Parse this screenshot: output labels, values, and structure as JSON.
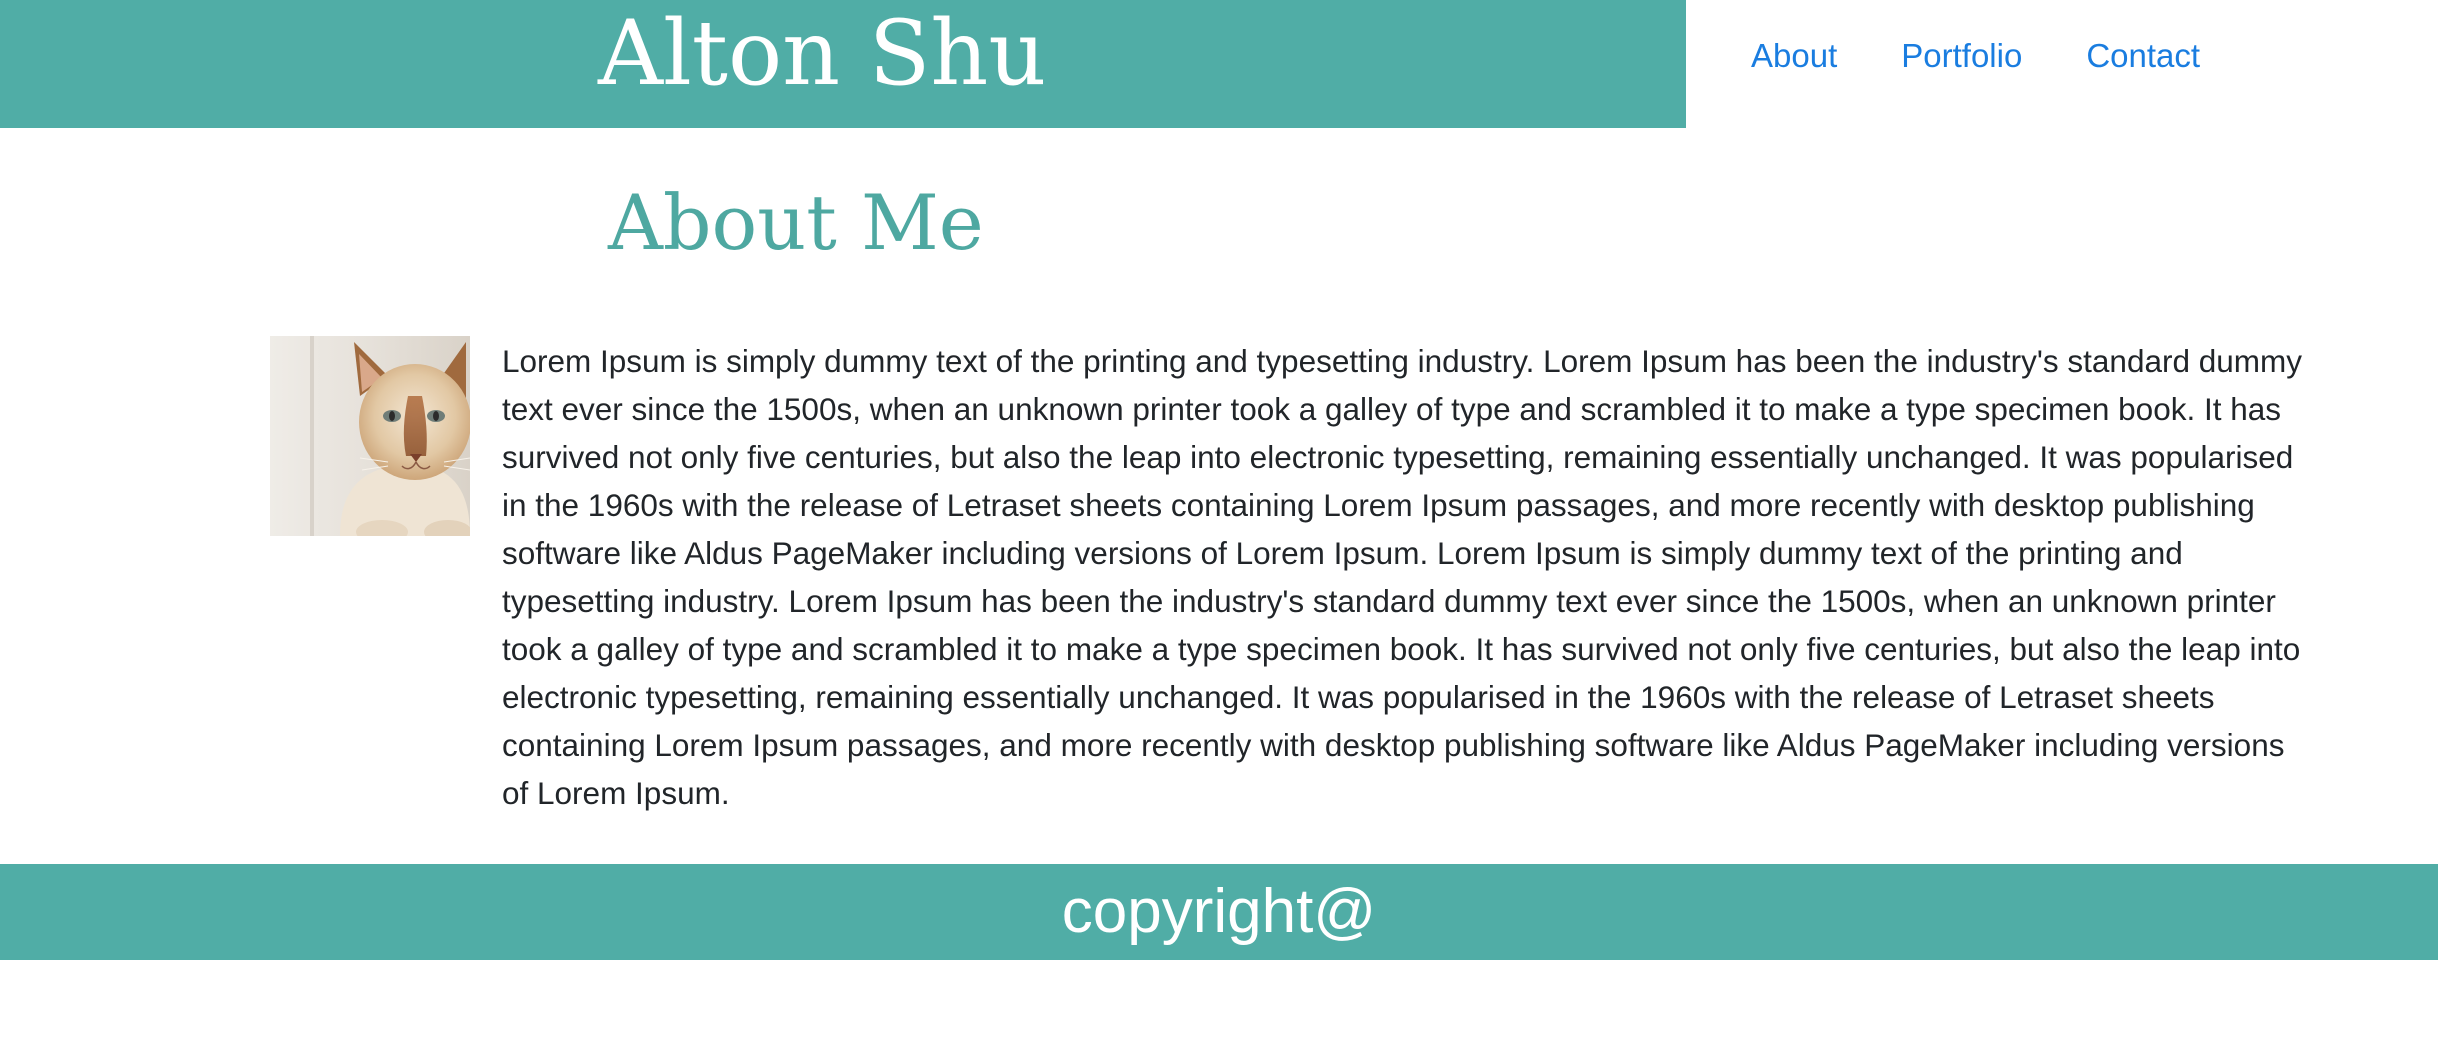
{
  "header": {
    "site_title": "Alton Shu",
    "nav": [
      {
        "label": "About"
      },
      {
        "label": "Portfolio"
      },
      {
        "label": "Contact"
      }
    ]
  },
  "main": {
    "section_title": "About Me",
    "photo_icon": "cat-photo",
    "bio": "Lorem Ipsum is simply dummy text of the printing and typesetting industry. Lorem Ipsum has been the industry's standard dummy text ever since the 1500s, when an unknown printer took a galley of type and scrambled it to make a type specimen book. It has survived not only five centuries, but also the leap into electronic typesetting, remaining essentially unchanged. It was popularised in the 1960s with the release of Letraset sheets containing Lorem Ipsum passages, and more recently with desktop publishing software like Aldus PageMaker including versions of Lorem Ipsum. Lorem Ipsum is simply dummy text of the printing and typesetting industry. Lorem Ipsum has been the industry's standard dummy text ever since the 1500s, when an unknown printer took a galley of type and scrambled it to make a type specimen book. It has survived not only five centuries, but also the leap into electronic typesetting, remaining essentially unchanged. It was popularised in the 1960s with the release of Letraset sheets containing Lorem Ipsum passages, and more recently with desktop publishing software like Aldus PageMaker including versions of Lorem Ipsum."
  },
  "footer": {
    "text": "copyright@"
  },
  "colors": {
    "brand_teal": "#50ada6",
    "heading_teal": "#4ea8a1",
    "link_blue": "#1a7de0",
    "body_text": "#212529"
  }
}
